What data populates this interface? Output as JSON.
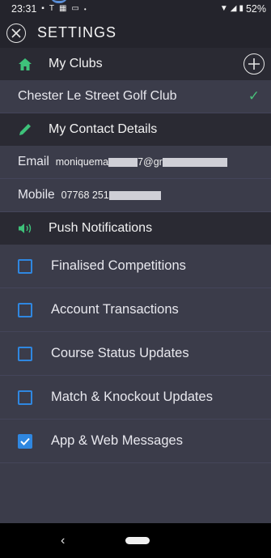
{
  "status_bar": {
    "time": "23:31",
    "left_icons": [
      "image-icon",
      "t-icon",
      "app-icon",
      "cast-icon",
      "dot-icon"
    ],
    "battery": "52%"
  },
  "header": {
    "title": "SETTINGS"
  },
  "my_clubs": {
    "label": "My Clubs",
    "clubs": [
      {
        "name": "Chester Le Street Golf Club",
        "selected": true
      }
    ]
  },
  "contact": {
    "label": "My Contact Details",
    "email_key": "Email",
    "email_prefix": "moniquema",
    "email_mid": "7@gr",
    "mobile_key": "Mobile",
    "mobile_prefix": "07768 251"
  },
  "push": {
    "label": "Push Notifications",
    "items": [
      {
        "label": "Finalised Competitions",
        "checked": false
      },
      {
        "label": "Account Transactions",
        "checked": false
      },
      {
        "label": "Course Status Updates",
        "checked": false
      },
      {
        "label": "Match & Knockout Updates",
        "checked": false
      },
      {
        "label": "App & Web Messages",
        "checked": true
      }
    ]
  },
  "nav": {
    "back": "‹"
  },
  "colors": {
    "header_bg": "#24242c",
    "row_bg": "#3b3c4a",
    "accent_green": "#48c07a",
    "checkbox_blue": "#2f87e0"
  }
}
